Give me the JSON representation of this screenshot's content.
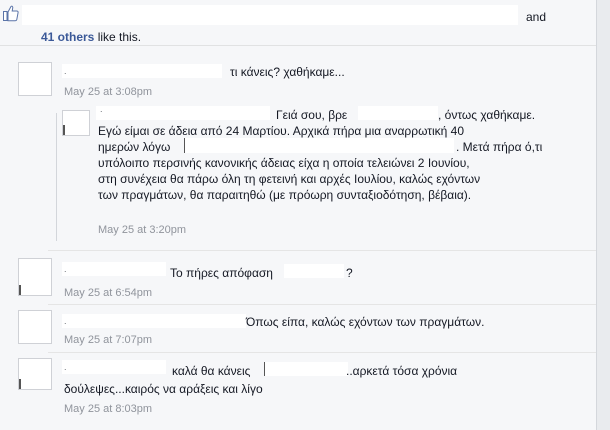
{
  "likes": {
    "tail": "and",
    "count_link": "41 others",
    "rest": "like this."
  },
  "comments": [
    {
      "text": "τι κάνεις? χαθήκαμε...",
      "time": "May 25 at 3:08pm"
    },
    {
      "lines": [
        "Γειά σου, βρε",
        ", όντως χαθήκαμε.",
        "Εγώ είμαι σε άδεια από 24 Μαρτίου. Αρχικά πήρα μια αναρρωτική 40",
        "ημερών λόγω",
        ". Μετά πήρα ό,τι",
        "υπόλοιπο περσινής κανονικής άδειας είχα η οποία τελειώνει 2 Ιουνίου,",
        "στη συνέχεια θα πάρω όλη τη φετεινή και αρχές Ιουλίου, καλώς εχόντων",
        "των πραγμάτων, θα παραιτηθώ (με πρόωρη συνταξιοδότηση, βέβαια)."
      ],
      "time": "May 25 at 3:20pm"
    },
    {
      "text_a": "Το πήρες απόφαση",
      "text_b": "?",
      "time": "May 25 at 6:54pm"
    },
    {
      "text": "Όπως είπα, καλώς εχόντων των πραγμάτων.",
      "time": "May 25 at 7:07pm"
    },
    {
      "line1_a": "καλά θα κάνεις",
      "line1_b": "..αρκετά τόσα χρόνια",
      "line2": "δούλεψες...καιρός να αράξεις και λίγο",
      "time": "May 25 at 8:03pm"
    }
  ],
  "colors": {
    "link": "#3b5998",
    "timestamp": "#90949c",
    "panel": "#f6f7f9"
  },
  "icons": {
    "like": "thumbs-up-icon"
  }
}
